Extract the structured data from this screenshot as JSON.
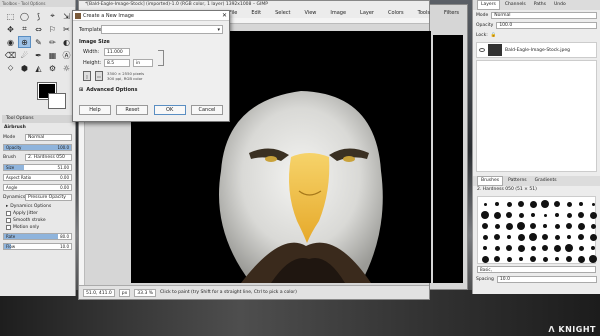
{
  "toolbox": {
    "title": "Toolbox - Tool Options",
    "tools": [
      "⬚",
      "◯",
      "⟆",
      "⌖",
      "⇲",
      "✥",
      "⌗",
      "⇔",
      "⚐",
      "✂",
      "◉",
      "⊕",
      "✎",
      "✏",
      "◐",
      "⌫",
      "☄",
      "✒",
      "▦",
      "Ⓐ",
      "⬦",
      "⬢",
      "◭",
      "⚙",
      "☼"
    ],
    "active_tool_index": 11,
    "options_tab": "Tool Options",
    "tool_name": "Airbrush",
    "mode_label": "Mode",
    "mode_value": "Normal",
    "opacity_label": "Opacity",
    "opacity_value": "100.0",
    "brush_label": "Brush",
    "brush_value": "2. Hardness 050",
    "size_label": "Size",
    "size_value": "51.00",
    "aspect_label": "Aspect Ratio",
    "aspect_value": "0.00",
    "angle_label": "Angle",
    "angle_value": "0.00",
    "dynamics_label": "Dynamics",
    "dynamics_value": "Pressure Opacity",
    "check_dynamics_options": "Dynamics Options",
    "check_jitter": "Apply Jitter",
    "check_smooth": "Smooth stroke",
    "check_motion": "Motion only",
    "rate_label": "Rate",
    "rate_value": "80.0",
    "flow_label": "Flow",
    "flow_value": "10.0"
  },
  "image_window": {
    "title": "*[Bald-Eagle-Image-Stock] (imported)-1.0 (RGB color, 1 layer) 1392x1008 – GIMP",
    "menus": [
      "File",
      "Edit",
      "Select",
      "View",
      "Image",
      "Layer",
      "Colors",
      "Tools",
      "Filters",
      "Windows",
      "Help"
    ],
    "status_coords": "51.0, 411.0",
    "status_unit": "px",
    "status_zoom": "33.3 %",
    "status_message": "Click to paint (try Shift for a straight line, Ctrl to pick a color)",
    "status_layer": "Background (8.0 MB)"
  },
  "dialog": {
    "title": "Create a New Image",
    "close": "✕",
    "template_label": "Template:",
    "template_value": "",
    "image_size_heading": "Image Size",
    "width_label": "Width:",
    "width_value": "11.000",
    "height_label": "Height:",
    "height_value": "8.5",
    "unit_value": "in",
    "info_pixels": "3300 × 2550 pixels",
    "info_res": "300 ppi, RGB color",
    "advanced_label": "Advanced Options",
    "btn_help": "Help",
    "btn_reset": "Reset",
    "btn_ok": "OK",
    "btn_cancel": "Cancel"
  },
  "dock": {
    "tabs": [
      "Layers",
      "Channels",
      "Paths",
      "Undo"
    ],
    "mode_label": "Mode",
    "mode_value": "Normal",
    "opacity_label": "Opacity",
    "opacity_value": "100.0",
    "lock_label": "Lock:",
    "layer_name": "Bald-Eagle-Image-Stock.jpeg",
    "brush_tabs": [
      "Brushes",
      "Patterns",
      "Gradients"
    ],
    "brush_title": "2. Hardness 050 (51 × 51)",
    "brush_tag_label": "Basic,",
    "spacing_label": "Spacing",
    "spacing_value": "10.0"
  },
  "watermark": {
    "prefix": "ᐱ",
    "text": "KNIGHT"
  }
}
